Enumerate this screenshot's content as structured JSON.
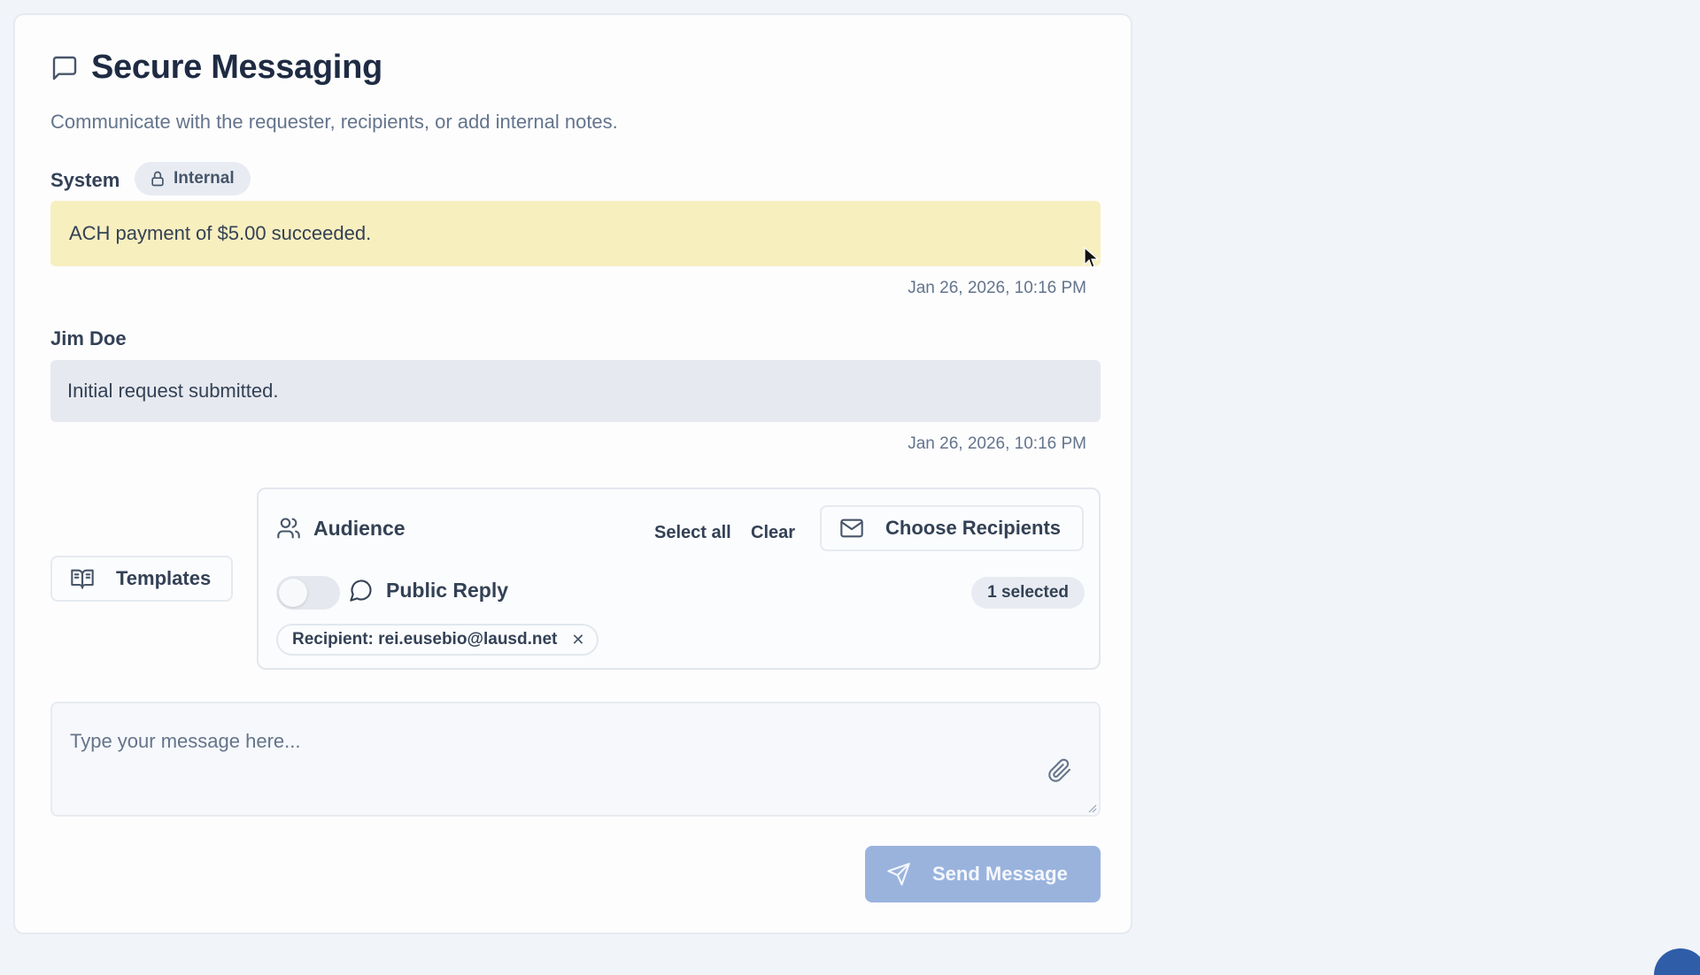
{
  "header": {
    "title": "Secure Messaging",
    "subtitle": "Communicate with the requester, recipients, or add internal notes."
  },
  "messages": [
    {
      "sender": "System",
      "badge": "Internal",
      "text": "ACH payment of $5.00 succeeded.",
      "timestamp": "Jan 26, 2026, 10:16 PM"
    },
    {
      "sender": "Jim Doe",
      "text": "Initial request submitted.",
      "timestamp": "Jan 26, 2026, 10:16 PM"
    }
  ],
  "templates": {
    "label": "Templates"
  },
  "audience": {
    "label": "Audience",
    "select_all": "Select all",
    "clear": "Clear",
    "choose_recipients": "Choose Recipients",
    "public_reply": "Public Reply",
    "public_reply_enabled": false,
    "selected_count": "1 selected",
    "recipients": [
      "Recipient: rei.eusebio@lausd.net"
    ],
    "remove_glyph": "✕"
  },
  "composer": {
    "placeholder": "Type your message here...",
    "value": ""
  },
  "send": {
    "label": "Send Message"
  },
  "colors": {
    "system_bubble": "#f8efbf",
    "user_bubble": "#e6e9ef",
    "send_button": "#9ab3dd",
    "title": "#1e2b42"
  },
  "icons": {
    "title": "message-square-icon",
    "internal": "lock-icon",
    "templates": "book-open-icon",
    "audience": "users-icon",
    "choose_recipients": "mail-icon",
    "public_reply": "message-circle-icon",
    "attach": "paperclip-icon",
    "send": "send-icon"
  }
}
